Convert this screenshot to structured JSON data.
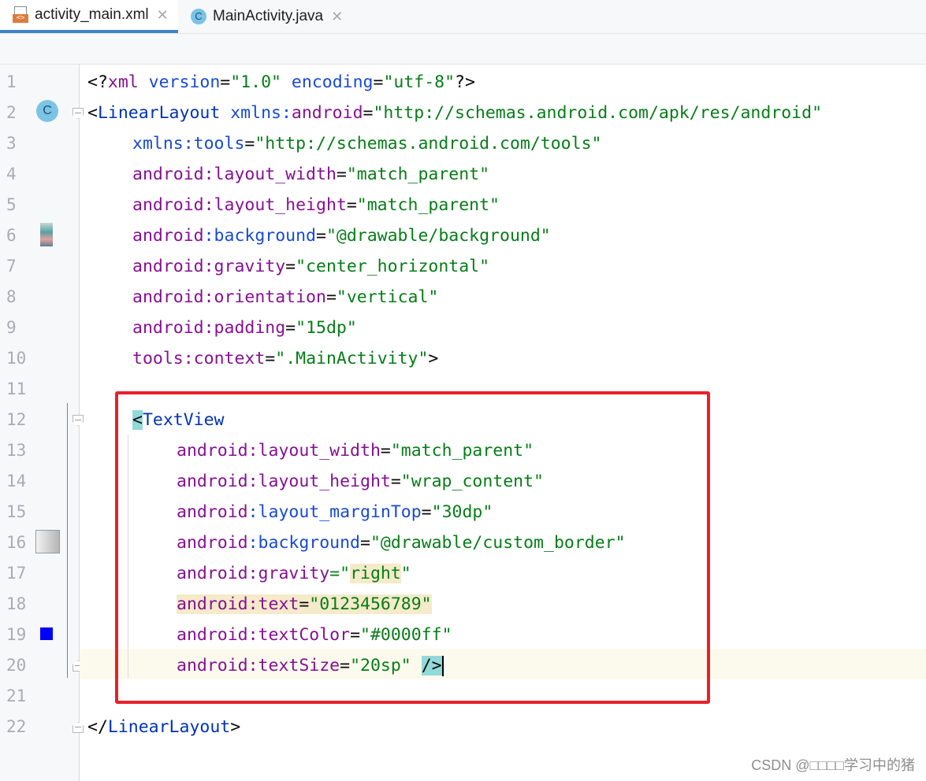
{
  "tabs": [
    {
      "label": "activity_main.xml",
      "icon": "xml-file-icon",
      "active": true
    },
    {
      "label": "MainActivity.java",
      "icon": "class-icon",
      "active": false
    }
  ],
  "line_numbers": [
    "1",
    "2",
    "3",
    "4",
    "5",
    "6",
    "7",
    "8",
    "9",
    "10",
    "11",
    "12",
    "13",
    "14",
    "15",
    "16",
    "17",
    "18",
    "19",
    "20",
    "21",
    "22"
  ],
  "code": {
    "l1": {
      "a": "<?",
      "b": "xml",
      "c": " version",
      "d": "=",
      "e": "\"1.0\"",
      "f": " encoding",
      "g": "=",
      "h": "\"utf-8\"",
      "i": "?>"
    },
    "l2": {
      "a": "<",
      "b": "LinearLayout",
      "c": " xmlns:",
      "d": "android",
      "e": "=",
      "f": "\"http://schemas.android.com/apk/res/android\""
    },
    "l3": {
      "a": "xmlns:",
      "b": "tools",
      "c": "=",
      "d": "\"http://schemas.android.com/tools\""
    },
    "l4": {
      "ns": "android",
      "name": ":layout_width",
      "eq": "=",
      "val": "\"match_parent\""
    },
    "l5": {
      "ns": "android",
      "name": ":layout_height",
      "eq": "=",
      "val": "\"match_parent\""
    },
    "l6": {
      "ns": "android",
      "name": ":background",
      "eq": "=",
      "val": "\"@drawable/background\""
    },
    "l7": {
      "ns": "android",
      "name": ":gravity",
      "eq": "=",
      "val": "\"center_horizontal\""
    },
    "l8": {
      "ns": "android",
      "name": ":orientation",
      "eq": "=",
      "val": "\"vertical\""
    },
    "l9": {
      "ns": "android",
      "name": ":padding",
      "eq": "=",
      "val": "\"15dp\""
    },
    "l10": {
      "ns": "tools",
      "name": ":context",
      "eq": "=",
      "val": "\".MainActivity\"",
      "end": ">"
    },
    "l12": {
      "a": "<",
      "b": "TextView"
    },
    "l13": {
      "ns": "android",
      "name": ":layout_width",
      "eq": "=",
      "val": "\"match_parent\""
    },
    "l14": {
      "ns": "android",
      "name": ":layout_height",
      "eq": "=",
      "val": "\"wrap_content\""
    },
    "l15": {
      "ns": "android",
      "name": ":layout_marginTop",
      "eq": "=",
      "val": "\"30dp\""
    },
    "l16": {
      "ns": "android",
      "name": ":background",
      "eq": "=",
      "val": "\"@drawable/custom_border\""
    },
    "l17": {
      "ns": "android",
      "name": ":gravity",
      "eq": "=\"",
      "val": "right",
      "q": "\""
    },
    "l18": {
      "ns": "android",
      "name": ":text",
      "eq": "=",
      "val": "\"0123456789\""
    },
    "l19": {
      "ns": "android",
      "name": ":textColor",
      "eq": "=",
      "val": "\"#0000ff\""
    },
    "l20": {
      "ns": "android",
      "name": ":textSize",
      "eq": "=",
      "val": "\"20sp\"",
      "end": "/>"
    },
    "l22": {
      "a": "</",
      "b": "LinearLayout",
      "c": ">"
    }
  },
  "gutter_icons": {
    "l2": "C",
    "l19_color": "#0000ff"
  },
  "watermark": "CSDN @□□□□学习中的猪",
  "colors": {
    "tag": "#0033b3",
    "namespace": "#871094",
    "value": "#067d17",
    "highlight_box": "#e8202a",
    "current_line": "#fcfaed"
  }
}
